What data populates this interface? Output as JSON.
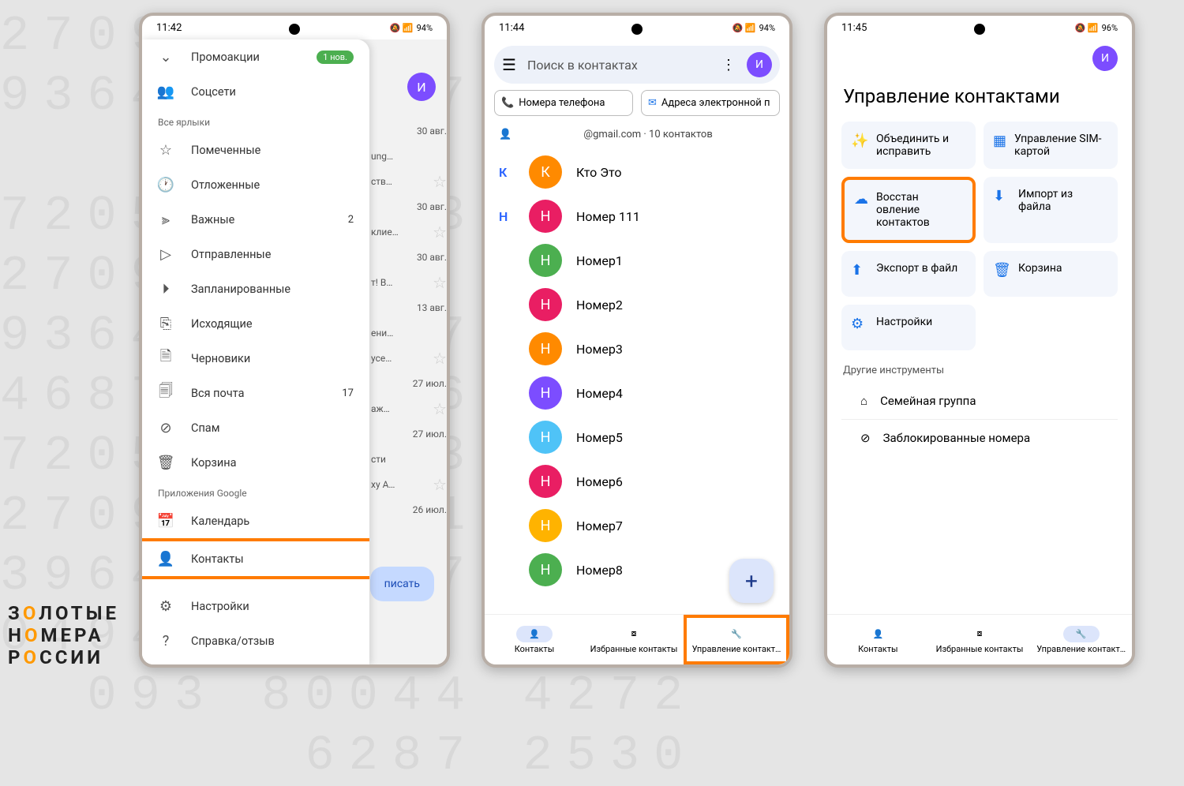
{
  "logo": {
    "l1": "З_ЛОТЫЕ",
    "l2": "Н_МЕРА",
    "l3": "Р_ССИИ",
    "o": "О"
  },
  "p1": {
    "time": "11:42",
    "battery": "94%",
    "promo": "Промоакции",
    "promo_badge": "1 нов.",
    "social": "Соцсети",
    "sec_labels": "Все ярлыки",
    "starred": "Помеченные",
    "snoozed": "Отложенные",
    "important": "Важные",
    "important_count": "2",
    "sent": "Отправленные",
    "scheduled": "Запланированные",
    "outbox": "Исходящие",
    "drafts": "Черновики",
    "allmail": "Вся почта",
    "allmail_count": "17",
    "spam": "Спам",
    "trash": "Корзина",
    "sec_apps": "Приложения Google",
    "calendar": "Календарь",
    "contacts": "Контакты",
    "settings": "Настройки",
    "help": "Справка/отзыв",
    "bg_dates": [
      "30 авг.",
      "30 авг.",
      "30 авг.",
      "13 авг.",
      "27 июл.",
      "27 июл.",
      "26 июл."
    ],
    "bg_subj": [
      "ung…",
      "клие…",
      "т! В…",
      "ени…",
      "аж…",
      "сти"
    ],
    "write": "писать",
    "avatar": "И"
  },
  "p2": {
    "time": "11:44",
    "battery": "94%",
    "search": "Поиск в контактах",
    "chip_phone": "Номера телефона",
    "chip_email": "Адреса электронной п",
    "account": "@gmail.com · 10 контактов",
    "letters": [
      "К",
      "Н"
    ],
    "contacts": [
      {
        "letter": "К",
        "name": "Кто Это",
        "color": "#ff8a00"
      },
      {
        "letter": "Н",
        "name": "Номер 111",
        "color": "#e91e63"
      },
      {
        "letter": "",
        "name": "Номер1",
        "color": "#4caf50"
      },
      {
        "letter": "",
        "name": "Номер2",
        "color": "#e91e63"
      },
      {
        "letter": "",
        "name": "Номер3",
        "color": "#ff8a00"
      },
      {
        "letter": "",
        "name": "Номер4",
        "color": "#7c4dff"
      },
      {
        "letter": "",
        "name": "Номер5",
        "color": "#4fc3f7"
      },
      {
        "letter": "",
        "name": "Номер6",
        "color": "#e91e63"
      },
      {
        "letter": "",
        "name": "Номер7",
        "color": "#ffb300"
      },
      {
        "letter": "",
        "name": "Номер8",
        "color": "#4caf50"
      }
    ],
    "nav": [
      "Контакты",
      "Избранные контакты",
      "Управление контакт…"
    ],
    "avatar": "И"
  },
  "p3": {
    "time": "11:45",
    "battery": "96%",
    "title": "Управление контактами",
    "tiles": [
      {
        "label": "Объединить и исправить",
        "ico": "✨"
      },
      {
        "label": "Управление SIM-картой",
        "ico": "▦"
      },
      {
        "label": "Восстан овление контактов",
        "ico": "☁",
        "hl": true
      },
      {
        "label": "Импорт из файла",
        "ico": "⬇"
      },
      {
        "label": "Экспорт в файл",
        "ico": "⬆"
      },
      {
        "label": "Корзина",
        "ico": "🗑"
      },
      {
        "label": "Настройки",
        "ico": "⚙",
        "full": false
      }
    ],
    "other_section": "Другие инструменты",
    "family": "Семейная группа",
    "blocked": "Заблокированные номера",
    "nav": [
      "Контакты",
      "Избранные контакты",
      "Управление контакт…"
    ],
    "avatar": "И"
  }
}
